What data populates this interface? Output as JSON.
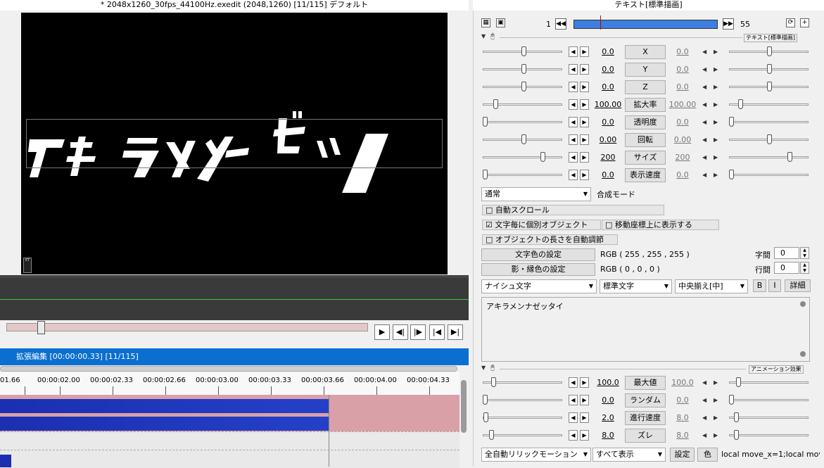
{
  "preview": {
    "title": "* 2048x1260_30fps_44100Hz.exedit (2048,1260)  [11/115]  デフォルト",
    "canvas_text_segments": [
      "アキ",
      "ラメメ",
      "ゼッ"
    ],
    "badge": "KT"
  },
  "playback": {
    "buttons": [
      "▶",
      "◀|",
      "|▶",
      "|◀",
      "▶|"
    ]
  },
  "timeline": {
    "header": "拡張編集 [00:00:00.33] [11/115]",
    "ticks": [
      "01.66",
      "00:00:02.00",
      "00:00:02.33",
      "00:00:02.66",
      "00:00:03.00",
      "00:00:03.33",
      "00:00:03.66",
      "00:00:04.00",
      "00:00:04.33"
    ]
  },
  "settings": {
    "title": "テキスト[標準描画]",
    "frame_start": "1",
    "frame_end": "55",
    "group1_tag": "テキスト[標準描画]",
    "params": [
      {
        "name": "X",
        "left": "0.0",
        "right": "0.0"
      },
      {
        "name": "Y",
        "left": "0.0",
        "right": "0.0"
      },
      {
        "name": "Z",
        "left": "0.0",
        "right": "0.0"
      },
      {
        "name": "拡大率",
        "left": "100.00",
        "right": "100.00"
      },
      {
        "name": "透明度",
        "left": "0.0",
        "right": "0.0"
      },
      {
        "name": "回転",
        "left": "0.00",
        "right": "0.00"
      },
      {
        "name": "サイズ",
        "left": "200",
        "right": "200"
      },
      {
        "name": "表示速度",
        "left": "0.0",
        "right": "0.0"
      }
    ],
    "blend_mode_value": "通常",
    "blend_mode_label": "合成モード",
    "check_auto_scroll": "□ 自動スクロール",
    "check_per_char": "☑ 文字毎に個別オブジェクト",
    "check_move_coord": "□ 移動座標上に表示する",
    "check_auto_length": "□ オブジェクトの長さを自動調節",
    "text_color_button": "文字色の設定",
    "text_color_value": "RGB ( 255 , 255 , 255 )",
    "shadow_color_button": "影・縁色の設定",
    "shadow_color_value": "RGB ( 0 , 0 , 0 )",
    "char_spacing_label": "字間",
    "char_spacing_value": "0",
    "line_spacing_label": "行間",
    "line_spacing_value": "0",
    "font_value": "ナイシュ文字",
    "style_value": "標準文字",
    "align_value": "中央揃え[中]",
    "bold_label": "B",
    "italic_label": "I",
    "detail_label": "詳細",
    "text_content": "アキラメンナゼッタイ",
    "group2_tag": "アニメーション効果",
    "anim_params": [
      {
        "name": "最大値",
        "left": "100.0",
        "right": "100.0"
      },
      {
        "name": "ランダム",
        "left": "0.0",
        "right": "0.0"
      },
      {
        "name": "進行速度",
        "left": "2.0",
        "right": "8.0"
      },
      {
        "name": "ズレ",
        "left": "8.0",
        "right": "8.0"
      }
    ],
    "anim_type_value": "全自動リリックモーション",
    "anim_display_value": "すべて表示",
    "anim_settings_label": "設定",
    "anim_color_label": "色",
    "anim_script_text": "local move_x=1;local mov"
  }
}
